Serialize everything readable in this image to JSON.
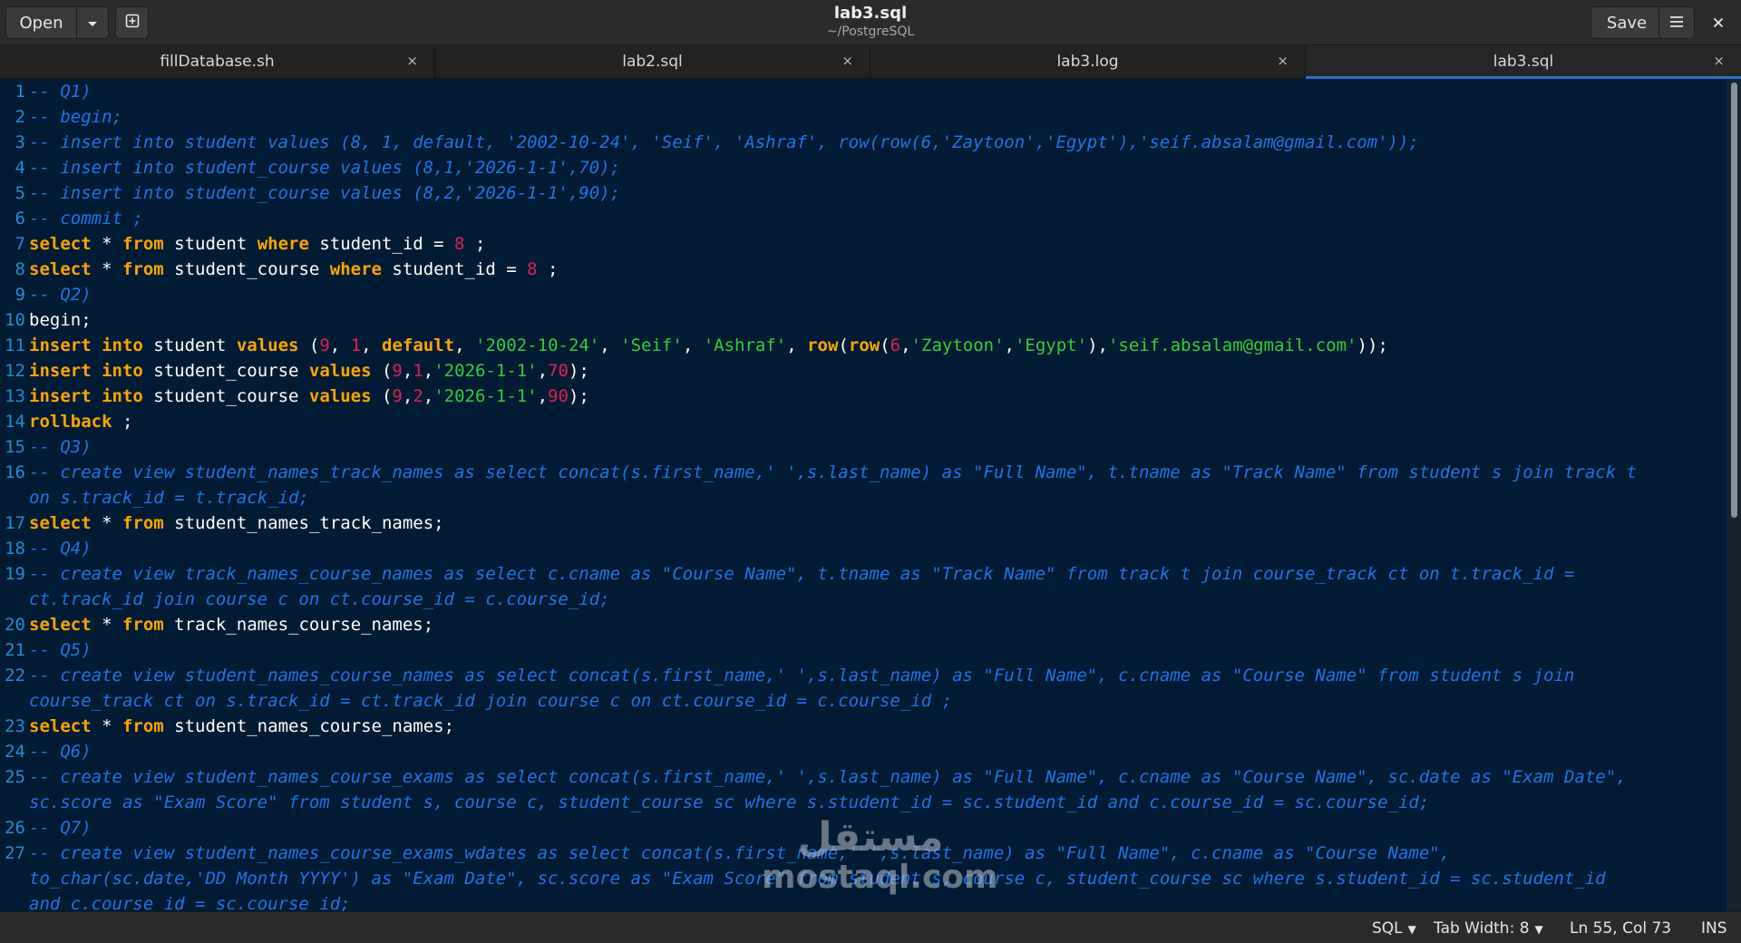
{
  "header": {
    "open_label": "Open",
    "open_dropdown_icon": "chevron-down-icon",
    "new_tab_icon": "new-document-icon",
    "title": "lab3.sql",
    "subtitle": "~/PostgreSQL",
    "save_label": "Save",
    "menu_icon": "hamburger-menu-icon",
    "close_icon": "close-icon"
  },
  "tabs": [
    {
      "label": "fillDatabase.sh",
      "close": "×",
      "active": false
    },
    {
      "label": "lab2.sql",
      "close": "×",
      "active": false
    },
    {
      "label": "lab3.log",
      "close": "×",
      "active": false
    },
    {
      "label": "lab3.sql",
      "close": "×",
      "active": true
    }
  ],
  "editor": {
    "lines": [
      {
        "n": "1",
        "rows": [
          [
            [
              "c",
              "-- Q1)"
            ]
          ]
        ]
      },
      {
        "n": "2",
        "rows": [
          [
            [
              "c",
              "-- begin;"
            ]
          ]
        ]
      },
      {
        "n": "3",
        "rows": [
          [
            [
              "c",
              "-- insert into student values (8, 1, default, '2002-10-24', 'Seif', 'Ashraf', row(row(6,'Zaytoon','Egypt'),'seif.absalam@gmail.com'));"
            ]
          ]
        ]
      },
      {
        "n": "4",
        "rows": [
          [
            [
              "c",
              "-- insert into student_course values (8,1,'2026-1-1',70);"
            ]
          ]
        ]
      },
      {
        "n": "5",
        "rows": [
          [
            [
              "c",
              "-- insert into student_course values (8,2,'2026-1-1',90);"
            ]
          ]
        ]
      },
      {
        "n": "6",
        "rows": [
          [
            [
              "c",
              "-- commit ;"
            ]
          ]
        ]
      },
      {
        "n": "7",
        "rows": [
          [
            [
              "k",
              "select"
            ],
            [
              "p",
              " * "
            ],
            [
              "k",
              "from"
            ],
            [
              "p",
              " student "
            ],
            [
              "k",
              "where"
            ],
            [
              "p",
              " student_id = "
            ],
            [
              "n",
              "8"
            ],
            [
              "p",
              " ;"
            ]
          ]
        ]
      },
      {
        "n": "8",
        "rows": [
          [
            [
              "k",
              "select"
            ],
            [
              "p",
              " * "
            ],
            [
              "k",
              "from"
            ],
            [
              "p",
              " student_course "
            ],
            [
              "k",
              "where"
            ],
            [
              "p",
              " student_id = "
            ],
            [
              "n",
              "8"
            ],
            [
              "p",
              " ;"
            ]
          ]
        ]
      },
      {
        "n": "9",
        "rows": [
          [
            [
              "c",
              "-- Q2)"
            ]
          ]
        ]
      },
      {
        "n": "10",
        "rows": [
          [
            [
              "p",
              "begin;"
            ]
          ]
        ]
      },
      {
        "n": "11",
        "rows": [
          [
            [
              "k",
              "insert"
            ],
            [
              "p",
              " "
            ],
            [
              "k",
              "into"
            ],
            [
              "p",
              " student "
            ],
            [
              "k",
              "values"
            ],
            [
              "p",
              " ("
            ],
            [
              "n",
              "9"
            ],
            [
              "p",
              ", "
            ],
            [
              "n",
              "1"
            ],
            [
              "p",
              ", "
            ],
            [
              "k",
              "default"
            ],
            [
              "p",
              ", "
            ],
            [
              "s",
              "'2002-10-24'"
            ],
            [
              "p",
              ", "
            ],
            [
              "s",
              "'Seif'"
            ],
            [
              "p",
              ", "
            ],
            [
              "s",
              "'Ashraf'"
            ],
            [
              "p",
              ", "
            ],
            [
              "k",
              "row"
            ],
            [
              "p",
              "("
            ],
            [
              "k",
              "row"
            ],
            [
              "p",
              "("
            ],
            [
              "n",
              "6"
            ],
            [
              "p",
              ","
            ],
            [
              "s",
              "'Zaytoon'"
            ],
            [
              "p",
              ","
            ],
            [
              "s",
              "'Egypt'"
            ],
            [
              "p",
              "),"
            ],
            [
              "s",
              "'seif.absalam@gmail.com'"
            ],
            [
              "p",
              "));"
            ]
          ]
        ]
      },
      {
        "n": "12",
        "rows": [
          [
            [
              "k",
              "insert"
            ],
            [
              "p",
              " "
            ],
            [
              "k",
              "into"
            ],
            [
              "p",
              " student_course "
            ],
            [
              "k",
              "values"
            ],
            [
              "p",
              " ("
            ],
            [
              "n",
              "9"
            ],
            [
              "p",
              ","
            ],
            [
              "n",
              "1"
            ],
            [
              "p",
              ","
            ],
            [
              "s",
              "'2026-1-1'"
            ],
            [
              "p",
              ","
            ],
            [
              "n",
              "70"
            ],
            [
              "p",
              ");"
            ]
          ]
        ]
      },
      {
        "n": "13",
        "rows": [
          [
            [
              "k",
              "insert"
            ],
            [
              "p",
              " "
            ],
            [
              "k",
              "into"
            ],
            [
              "p",
              " student_course "
            ],
            [
              "k",
              "values"
            ],
            [
              "p",
              " ("
            ],
            [
              "n",
              "9"
            ],
            [
              "p",
              ","
            ],
            [
              "n",
              "2"
            ],
            [
              "p",
              ","
            ],
            [
              "s",
              "'2026-1-1'"
            ],
            [
              "p",
              ","
            ],
            [
              "n",
              "90"
            ],
            [
              "p",
              ");"
            ]
          ]
        ]
      },
      {
        "n": "14",
        "rows": [
          [
            [
              "k",
              "rollback"
            ],
            [
              "p",
              " ;"
            ]
          ]
        ]
      },
      {
        "n": "15",
        "rows": [
          [
            [
              "c",
              "-- Q3)"
            ]
          ]
        ]
      },
      {
        "n": "16",
        "rows": [
          [
            [
              "c",
              "-- create view student_names_track_names as select concat(s.first_name,' ',s.last_name) as \"Full Name\", t.tname as \"Track Name\" from student s join track t"
            ]
          ],
          [
            [
              "c",
              "on s.track_id = t.track_id;"
            ]
          ]
        ]
      },
      {
        "n": "17",
        "rows": [
          [
            [
              "k",
              "select"
            ],
            [
              "p",
              " * "
            ],
            [
              "k",
              "from"
            ],
            [
              "p",
              " student_names_track_names;"
            ]
          ]
        ]
      },
      {
        "n": "18",
        "rows": [
          [
            [
              "c",
              "-- Q4)"
            ]
          ]
        ]
      },
      {
        "n": "19",
        "rows": [
          [
            [
              "c",
              "-- create view track_names_course_names as select c.cname as \"Course Name\", t.tname as \"Track Name\" from track t join course_track ct on t.track_id ="
            ]
          ],
          [
            [
              "c",
              "ct.track_id join course c on ct.course_id = c.course_id;"
            ]
          ]
        ]
      },
      {
        "n": "20",
        "rows": [
          [
            [
              "k",
              "select"
            ],
            [
              "p",
              " * "
            ],
            [
              "k",
              "from"
            ],
            [
              "p",
              " track_names_course_names;"
            ]
          ]
        ]
      },
      {
        "n": "21",
        "rows": [
          [
            [
              "c",
              "-- Q5)"
            ]
          ]
        ]
      },
      {
        "n": "22",
        "rows": [
          [
            [
              "c",
              "-- create view student_names_course_names as select concat(s.first_name,' ',s.last_name) as \"Full Name\", c.cname as \"Course Name\" from student s join"
            ]
          ],
          [
            [
              "c",
              "course_track ct on s.track_id = ct.track_id join course c on ct.course_id = c.course_id ;"
            ]
          ]
        ]
      },
      {
        "n": "23",
        "rows": [
          [
            [
              "k",
              "select"
            ],
            [
              "p",
              " * "
            ],
            [
              "k",
              "from"
            ],
            [
              "p",
              " student_names_course_names;"
            ]
          ]
        ]
      },
      {
        "n": "24",
        "rows": [
          [
            [
              "c",
              "-- Q6)"
            ]
          ]
        ]
      },
      {
        "n": "25",
        "rows": [
          [
            [
              "c",
              "-- create view student_names_course_exams as select concat(s.first_name,' ',s.last_name) as \"Full Name\", c.cname as \"Course Name\", sc.date as \"Exam Date\","
            ]
          ],
          [
            [
              "c",
              "sc.score as \"Exam Score\" from student s, course c, student_course sc where s.student_id = sc.student_id and c.course_id = sc.course_id;"
            ]
          ]
        ]
      },
      {
        "n": "26",
        "rows": [
          [
            [
              "c",
              "-- Q7)"
            ]
          ]
        ]
      },
      {
        "n": "27",
        "rows": [
          [
            [
              "c",
              "-- create view student_names_course_exams_wdates as select concat(s.first_name,' ',s.last_name) as \"Full Name\", c.cname as \"Course Name\","
            ]
          ],
          [
            [
              "c",
              "to_char(sc.date,'DD Month YYYY') as \"Exam Date\", sc.score as \"Exam Score\" from student s, course c, student_course sc where s.student_id = sc.student_id"
            ]
          ],
          [
            [
              "c",
              "and c.course_id = sc.course_id;"
            ]
          ]
        ]
      }
    ]
  },
  "watermark": {
    "arabic": "مستقل",
    "latin": "mostaql.com"
  },
  "status": {
    "language": "SQL",
    "tab_width": "Tab Width: 8",
    "position": "Ln 55, Col 73",
    "mode": "INS",
    "dropdown_icon": "chevron-down-icon"
  },
  "colors": {
    "background": "#001b33",
    "comment": "#1c74e8",
    "keyword": "#ffa500",
    "string": "#32ce3a",
    "number": "#e01f55",
    "line_number": "#1f8dd6",
    "accent": "#2e6ec9"
  }
}
